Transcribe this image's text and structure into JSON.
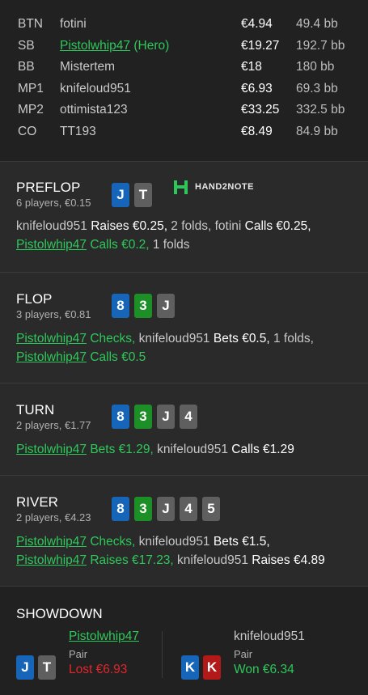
{
  "players": [
    {
      "pos": "BTN",
      "name": "fotini",
      "stack": "€4.94",
      "bb": "49.4 bb",
      "hero": false
    },
    {
      "pos": "SB",
      "name": "Pistolwhip47",
      "hero_label": " (Hero)",
      "stack": "€19.27",
      "bb": "192.7 bb",
      "hero": true
    },
    {
      "pos": "BB",
      "name": "Mistertem",
      "stack": "€18",
      "bb": "180 bb",
      "hero": false
    },
    {
      "pos": "MP1",
      "name": "knifeloud951",
      "stack": "€6.93",
      "bb": "69.3 bb",
      "hero": false
    },
    {
      "pos": "MP2",
      "name": "ottimista123",
      "stack": "€33.25",
      "bb": "332.5 bb",
      "hero": false
    },
    {
      "pos": "CO",
      "name": "TT193",
      "stack": "€8.49",
      "bb": "84.9 bb",
      "hero": false
    }
  ],
  "logo": {
    "text": "HAND2NOTE",
    "color": "#2ec85a"
  },
  "streets": [
    {
      "title": "PREFLOP",
      "sub": "6 players, €0.15",
      "cards": [
        {
          "r": "J",
          "c": "blue"
        },
        {
          "r": "T",
          "c": "gray"
        }
      ],
      "lines": [
        [
          {
            "t": "knifeloud951 ",
            "k": "player"
          },
          {
            "t": "Raises €0.25,",
            "k": "action"
          },
          {
            "t": " 2 folds, ",
            "k": "plain"
          },
          {
            "t": "fotini ",
            "k": "player"
          },
          {
            "t": "Calls €0.25,",
            "k": "action"
          }
        ],
        [
          {
            "t": "Pistolwhip47",
            "k": "hero"
          },
          {
            "t": " Calls €0.2,",
            "k": "heroaction"
          },
          {
            "t": " 1 folds",
            "k": "plain"
          }
        ]
      ]
    },
    {
      "title": "FLOP",
      "sub": "3 players, €0.81",
      "cards": [
        {
          "r": "8",
          "c": "blue"
        },
        {
          "r": "3",
          "c": "green"
        },
        {
          "r": "J",
          "c": "gray"
        }
      ],
      "lines": [
        [
          {
            "t": "Pistolwhip47",
            "k": "hero"
          },
          {
            "t": " Checks,",
            "k": "heroaction"
          },
          {
            "t": " knifeloud951 ",
            "k": "player"
          },
          {
            "t": "Bets €0.5,",
            "k": "action"
          },
          {
            "t": " 1 folds,",
            "k": "plain"
          }
        ],
        [
          {
            "t": "Pistolwhip47",
            "k": "hero"
          },
          {
            "t": " Calls €0.5",
            "k": "heroaction"
          }
        ]
      ]
    },
    {
      "title": "TURN",
      "sub": "2 players, €1.77",
      "cards": [
        {
          "r": "8",
          "c": "blue"
        },
        {
          "r": "3",
          "c": "green"
        },
        {
          "r": "J",
          "c": "gray"
        },
        {
          "r": "4",
          "c": "gray"
        }
      ],
      "lines": [
        [
          {
            "t": "Pistolwhip47",
            "k": "hero"
          },
          {
            "t": " Bets €1.29,",
            "k": "heroaction"
          },
          {
            "t": " knifeloud951 ",
            "k": "player"
          },
          {
            "t": "Calls €1.29",
            "k": "action"
          }
        ]
      ]
    },
    {
      "title": "RIVER",
      "sub": "2 players, €4.23",
      "cards": [
        {
          "r": "8",
          "c": "blue"
        },
        {
          "r": "3",
          "c": "green"
        },
        {
          "r": "J",
          "c": "gray"
        },
        {
          "r": "4",
          "c": "gray"
        },
        {
          "r": "5",
          "c": "gray"
        }
      ],
      "lines": [
        [
          {
            "t": "Pistolwhip47",
            "k": "hero"
          },
          {
            "t": " Checks,",
            "k": "heroaction"
          },
          {
            "t": " knifeloud951 ",
            "k": "player"
          },
          {
            "t": "Bets €1.5,",
            "k": "action"
          }
        ],
        [
          {
            "t": "Pistolwhip47",
            "k": "hero"
          },
          {
            "t": " Raises €17.23,",
            "k": "heroaction"
          },
          {
            "t": " knifeloud951 ",
            "k": "player"
          },
          {
            "t": "Raises €4.89",
            "k": "action"
          }
        ]
      ]
    }
  ],
  "showdown": {
    "title": "SHOWDOWN",
    "hands": [
      {
        "name": "Pistolwhip47",
        "rank": "Pair",
        "result": "Lost €6.93",
        "won": false,
        "hero": true,
        "cards": [
          {
            "r": "J",
            "c": "blue"
          },
          {
            "r": "T",
            "c": "gray"
          }
        ]
      },
      {
        "name": "knifeloud951",
        "rank": "Pair",
        "result": "Won €6.34",
        "won": true,
        "hero": false,
        "cards": [
          {
            "r": "K",
            "c": "blue"
          },
          {
            "r": "K",
            "c": "red"
          }
        ]
      }
    ]
  },
  "colors": {
    "hero": "#2ec85a",
    "lost": "#e0262b",
    "won": "#2ec85a",
    "card_blue": "#1665b8",
    "card_green": "#1c8f26",
    "card_gray": "#5f5f5f",
    "card_red": "#b31919"
  }
}
